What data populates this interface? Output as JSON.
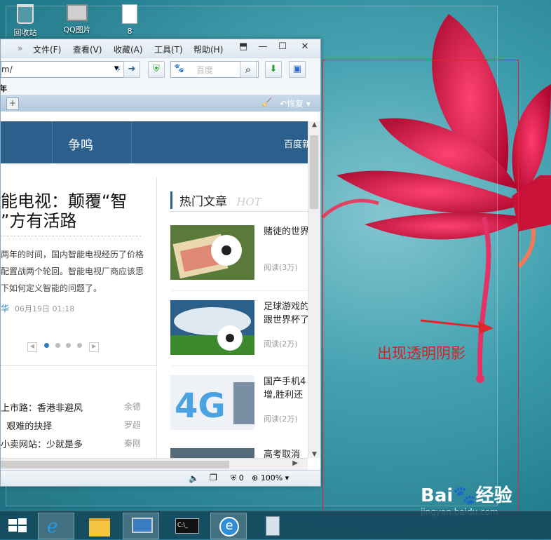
{
  "desktop": {
    "icons": [
      {
        "label": "回收站",
        "icon": "recycle-bin-icon"
      },
      {
        "label": "QQ图片",
        "icon": "image-folder-icon"
      },
      {
        "label": "8",
        "icon": "file-icon"
      }
    ],
    "annotation_text": "出现透明阴影"
  },
  "browser": {
    "menu": [
      "文件(F)",
      "查看(V)",
      "收藏(A)",
      "工具(T)",
      "帮助(H)"
    ],
    "address": "m/",
    "search_placeholder": "百度",
    "fav_char": "年",
    "restore_label": "恢复",
    "nav": {
      "item": "争鸣",
      "right": "百度新"
    },
    "article": {
      "title_line1": "能电视：颠覆“智",
      "title_line2": "”方有活路",
      "summary_line1": "两年的时间，国内智能电视经历了价格",
      "summary_line2": "配置战两个轮回。智能电视厂商应该思",
      "summary_line3": "下如何定义智能的问题了。",
      "author": "华",
      "date": "06月19日 01:18"
    },
    "hot": {
      "title": "热门文章",
      "tag": "HOT",
      "items": [
        {
          "title": "赌徒的世界",
          "read": "阅读(3万)",
          "thumb": "soccer-money-thumb"
        },
        {
          "title_line1": "足球游戏的",
          "title_line2": "跟世界杯了",
          "read": "阅读(2万)",
          "thumb": "soccer-stadium-thumb"
        },
        {
          "title_line1": "国产手机4",
          "title_line2": "增,胜利还",
          "read": "阅读(2万)",
          "thumb": "4g-thumb"
        },
        {
          "title": "高考取消"
        }
      ]
    },
    "list": [
      {
        "title": "上市路：香港非避风",
        "author": "余德"
      },
      {
        "title": "  艰难的抉择",
        "author": "罗超"
      },
      {
        "title": "小卖网站：少就是多",
        "author": "秦刚"
      }
    ],
    "status": {
      "count": "0",
      "zoom": "100%"
    }
  },
  "watermark": {
    "brand": "Bai",
    "brand2": "经验",
    "url": "jingyan.baidu.com"
  }
}
